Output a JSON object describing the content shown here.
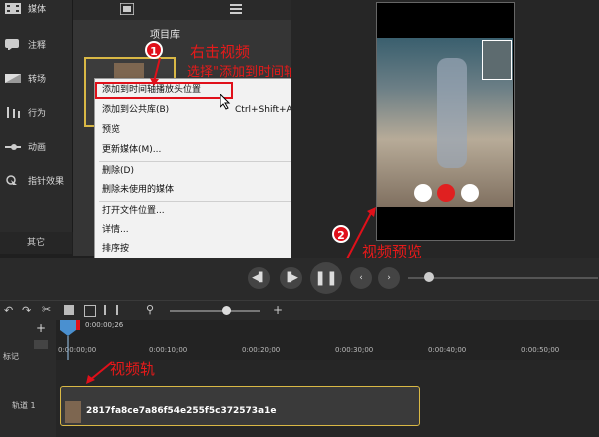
{
  "sidebar": {
    "items": [
      {
        "label": "媒体",
        "icon": "film-icon"
      },
      {
        "label": "注释",
        "icon": "annotation-icon"
      },
      {
        "label": "转场",
        "icon": "transition-icon"
      },
      {
        "label": "行为",
        "icon": "behavior-icon"
      },
      {
        "label": "动画",
        "icon": "animation-icon"
      },
      {
        "label": "指针效果",
        "icon": "cursor-effect-icon"
      }
    ],
    "other_label": "其它",
    "add_label": "+"
  },
  "library": {
    "title": "项目库"
  },
  "context_menu": {
    "items": [
      {
        "label": "添加到时间轴播放头位置",
        "shortcut": ""
      },
      {
        "label": "添加到公共库(B)",
        "shortcut": "Ctrl+Shift+A"
      },
      {
        "label": "预览",
        "shortcut": ""
      },
      {
        "label": "更新媒体(M)...",
        "shortcut": ""
      },
      {
        "label": "删除(D)",
        "shortcut": ""
      },
      {
        "label": "删除未使用的媒体",
        "shortcut": ""
      },
      {
        "label": "打开文件位置...",
        "shortcut": ""
      },
      {
        "label": "详情...",
        "shortcut": ""
      },
      {
        "label": "排序按",
        "shortcut": ""
      }
    ]
  },
  "annotations": {
    "badge1": "1",
    "step1_line1": "右击视频",
    "step1_line2": "选择\"添加到时间轴..\"",
    "badge2": "2",
    "step2": "视频预览",
    "step3": "视频轨"
  },
  "timeline": {
    "playhead_time": "0:00:00;26",
    "marker_label": "标记",
    "track_label": "轨道 1",
    "ticks": [
      "0:00:00;00",
      "0:00:10;00",
      "0:00:20;00",
      "0:00:30;00",
      "0:00:40;00",
      "0:00:50;00"
    ],
    "clip_name": "2817fa8ce7a86f54e255f5c372573a1e"
  },
  "colors": {
    "accent": "#e0101a",
    "clip_border": "#d9b845"
  }
}
